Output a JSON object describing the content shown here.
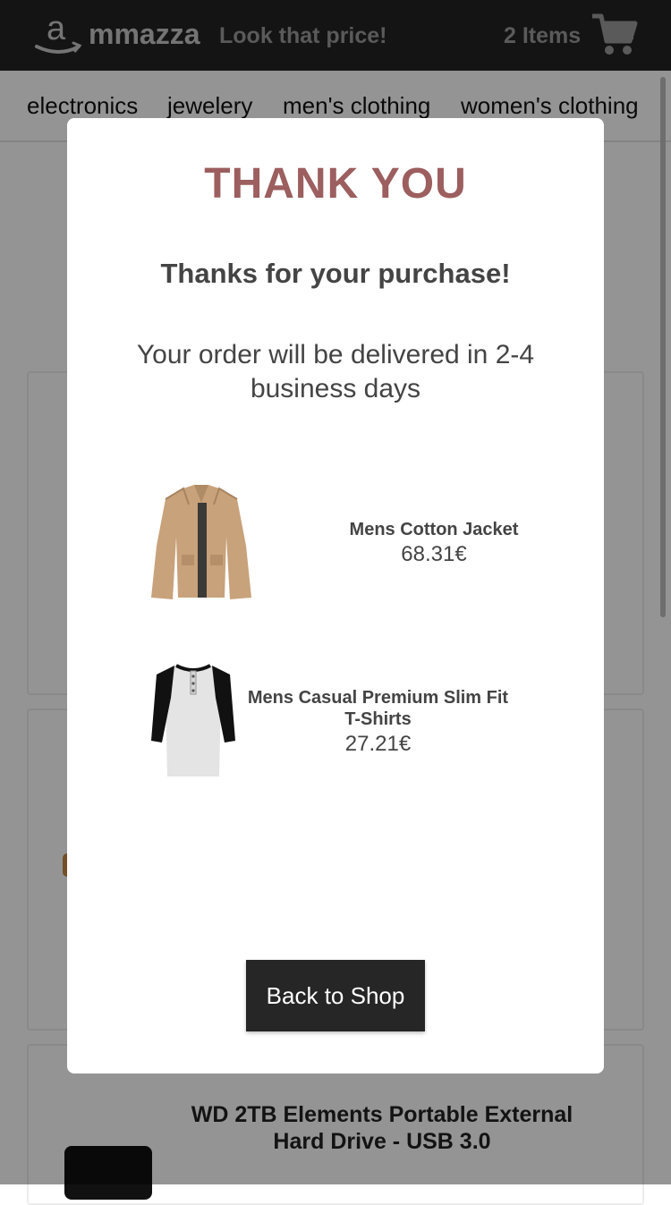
{
  "header": {
    "brand": "mmazza",
    "tagline": "Look that price!",
    "cart_count": "2 Items"
  },
  "categories": [
    "electronics",
    "jewelery",
    "men's clothing",
    "women's clothing"
  ],
  "background": {
    "visible_product_title": "WD 2TB Elements Portable External Hard Drive - USB 3.0"
  },
  "modal": {
    "title": "THANK YOU",
    "subtitle": "Thanks for your purchase!",
    "message": "Your order will be delivered in 2-4 business days",
    "items": [
      {
        "name": "Mens Cotton Jacket",
        "price": "68.31€"
      },
      {
        "name": "Mens Casual Premium Slim Fit T-Shirts",
        "price": "27.21€"
      }
    ],
    "back_button": "Back to Shop"
  },
  "colors": {
    "header_bg": "#242424",
    "title_accent": "#9c5e5e",
    "button_bg": "#262626"
  }
}
